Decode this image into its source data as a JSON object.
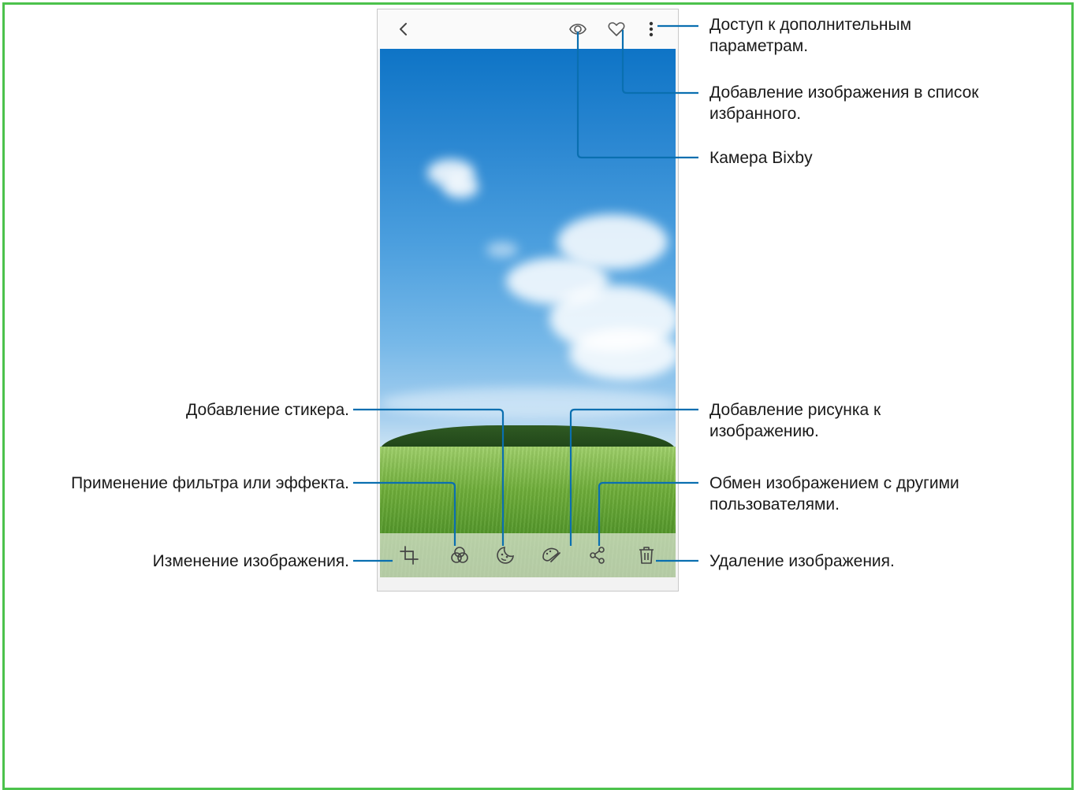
{
  "accent_color": "#0a6fb0",
  "frame_color": "#4cc24c",
  "callouts": {
    "more_options": [
      "Доступ к дополнительным",
      "параметрам."
    ],
    "favourite": [
      "Добавление изображения в список",
      "избранного."
    ],
    "bixby_vision": "Камера Bixby",
    "add_sticker": "Добавление стикера.",
    "filter_effect": "Применение фильтра или эффекта.",
    "edit_image": "Изменение изображения.",
    "add_drawing": [
      "Добавление рисунка к",
      "изображению."
    ],
    "share_image": [
      "Обмен изображением с другими",
      "пользователями."
    ],
    "delete_image": "Удаление изображения."
  },
  "toolbar_icons": {
    "top": [
      "back-icon",
      "bixby-vision-icon",
      "heart-icon",
      "more-options-icon"
    ],
    "bottom": [
      "crop-icon",
      "filter-icon",
      "sticker-icon",
      "draw-icon",
      "share-icon",
      "trash-icon"
    ]
  }
}
